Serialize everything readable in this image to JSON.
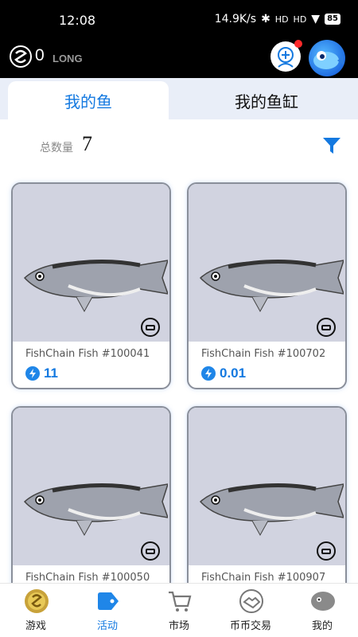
{
  "status_bar": {
    "time": "12:08",
    "network_speed": "14.9K/s",
    "signal1": "HD",
    "signal2": "HD",
    "battery": "85"
  },
  "header": {
    "coin_count": "0",
    "coin_unit": "LONG"
  },
  "tabs": [
    {
      "label": "我的鱼",
      "active": true
    },
    {
      "label": "我的鱼缸",
      "active": false
    }
  ],
  "summary": {
    "total_label": "总数量",
    "total_value": "7"
  },
  "fish_cards": [
    {
      "name": "FishChain Fish #100041",
      "price": "11"
    },
    {
      "name": "FishChain Fish #100702",
      "price": "0.01"
    },
    {
      "name": "FishChain Fish #100050",
      "price": ""
    },
    {
      "name": "FishChain Fish #100907",
      "price": ""
    }
  ],
  "bottom_nav": [
    {
      "label": "游戏",
      "icon": "game-coin-icon"
    },
    {
      "label": "活动",
      "icon": "tag-icon",
      "active": true
    },
    {
      "label": "市场",
      "icon": "cart-icon"
    },
    {
      "label": "币币交易",
      "icon": "handshake-icon"
    },
    {
      "label": "我的",
      "icon": "fish-profile-icon"
    }
  ],
  "colors": {
    "accent": "#1479e0",
    "card_bg": "#d1d3e0",
    "tab_bar_bg": "#e9eef8"
  }
}
